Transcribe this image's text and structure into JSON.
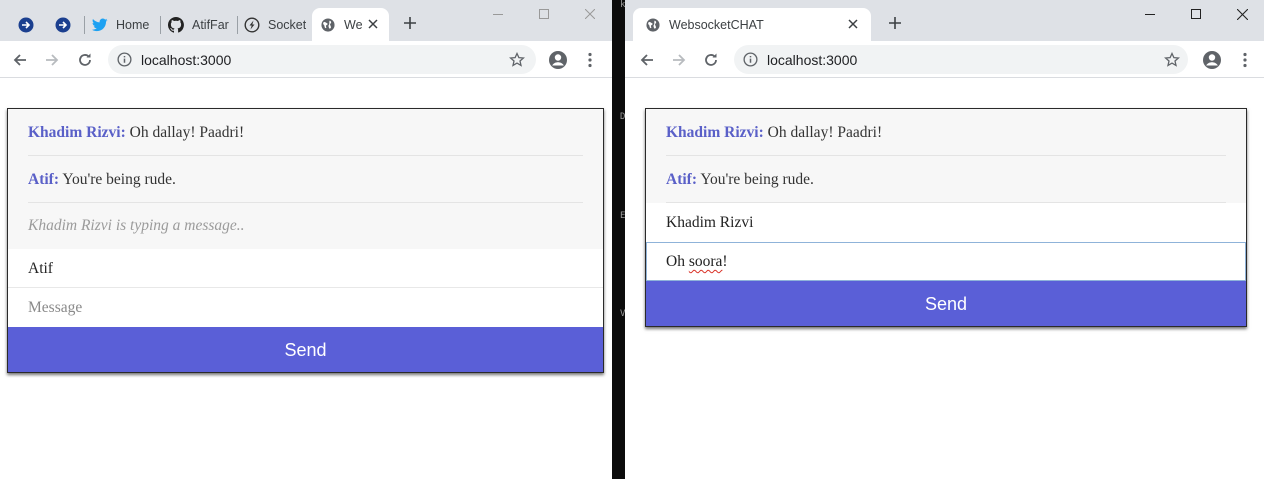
{
  "left_window": {
    "tabs": [
      {
        "title": "",
        "icon": "edge-app-icon"
      },
      {
        "title": "",
        "icon": "edge-app-icon"
      },
      {
        "title": "Home",
        "icon": "twitter-icon"
      },
      {
        "title": "AtifFar",
        "icon": "github-icon"
      },
      {
        "title": "Socket",
        "icon": "socketio-icon"
      },
      {
        "title": "We",
        "icon": "globe-icon"
      }
    ],
    "url": "localhost:3000",
    "chat": {
      "messages": [
        {
          "author": "Khadim Rizvi:",
          "text": "Oh dallay! Paadri!"
        },
        {
          "author": "Atif:",
          "text": "You're being rude."
        }
      ],
      "typing": "Khadim Rizvi is typing a message..",
      "name_value": "Atif",
      "message_placeholder": "Message",
      "send_label": "Send"
    }
  },
  "right_window": {
    "tab_title": "WebsocketCHAT",
    "url": "localhost:3000",
    "chat": {
      "messages": [
        {
          "author": "Khadim Rizvi:",
          "text": "Oh dallay! Paadri!"
        },
        {
          "author": "Atif:",
          "text": "You're being rude."
        }
      ],
      "name_value": "Khadim Rizvi",
      "message_prefix": "Oh ",
      "message_misspelled": "soora",
      "message_suffix": "!",
      "send_label": "Send"
    }
  },
  "colors": {
    "accent": "#5a5fd7",
    "author": "#5a60c8",
    "tabbar": "#dee1e6"
  }
}
